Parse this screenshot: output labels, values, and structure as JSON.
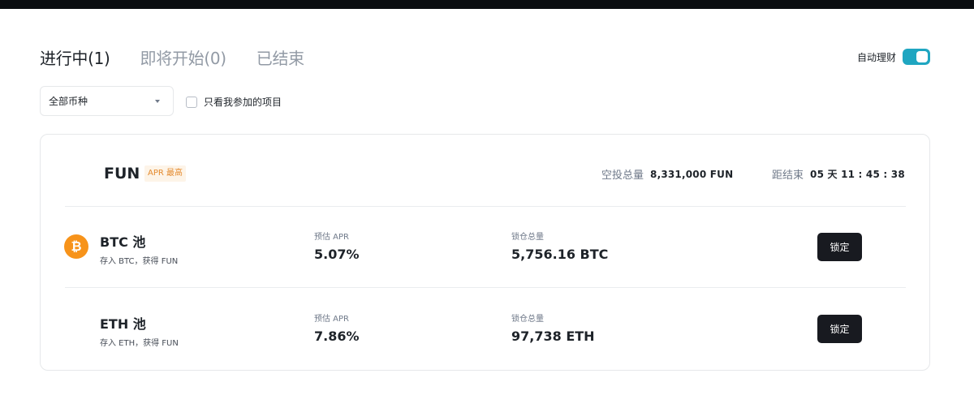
{
  "tabs": [
    {
      "label": "进行中(1)",
      "active": true
    },
    {
      "label": "即将开始(0)",
      "active": false
    },
    {
      "label": "已结束",
      "active": false
    }
  ],
  "auto_invest": {
    "label": "自动理财",
    "enabled": true
  },
  "coin_select": {
    "value": "全部币种"
  },
  "filter": {
    "label": "只看我参加的项目",
    "checked": false
  },
  "project": {
    "coin": "FUN",
    "badge": "APR 最高",
    "airdrop_label": "空投总量",
    "airdrop_value": "8,331,000 FUN",
    "countdown_label": "距结束",
    "countdown_value": "05 天 11 : 45 : 38",
    "pools": [
      {
        "title": "BTC 池",
        "subtitle": "存入 BTC，获得 FUN",
        "icon": "bitcoin-icon",
        "icon_glyph": "₿",
        "apr_label": "预估 APR",
        "apr_value": "5.07%",
        "locked_label": "锁仓总量",
        "locked_value": "5,756.16 BTC",
        "button": "锁定"
      },
      {
        "title": "ETH 池",
        "subtitle": "存入 ETH，获得 FUN",
        "apr_label": "预估 APR",
        "apr_value": "7.86%",
        "locked_label": "锁仓总量",
        "locked_value": "97,738 ETH",
        "button": "锁定"
      }
    ]
  },
  "colors": {
    "accent": "#1fa6c1",
    "badge_text": "#e48a2e",
    "button_bg": "#181a20",
    "btc_orange": "#f7931a"
  }
}
